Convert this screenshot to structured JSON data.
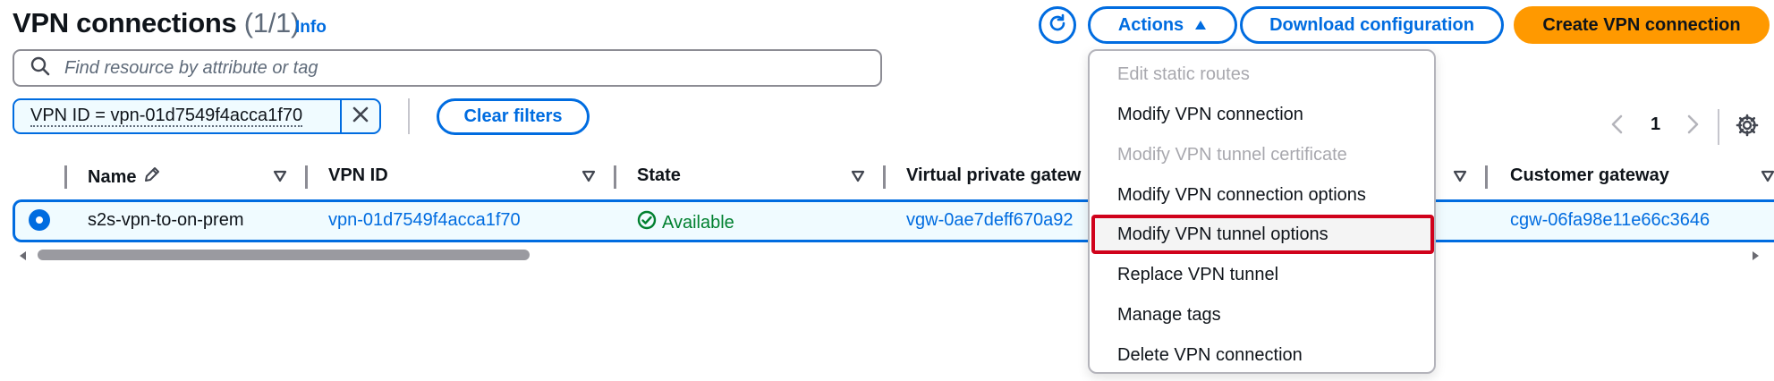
{
  "header": {
    "title": "VPN connections",
    "count": "(1/1)",
    "info": "Info"
  },
  "toolbar": {
    "actions_label": "Actions",
    "download_label": "Download configuration",
    "create_label": "Create VPN connection"
  },
  "search": {
    "placeholder": "Find resource by attribute or tag",
    "value": ""
  },
  "filter": {
    "token": "VPN ID = vpn-01d7549f4acca1f70",
    "clear_label": "Clear filters"
  },
  "pagination": {
    "current_page": "1"
  },
  "table": {
    "columns": [
      "Name",
      "VPN ID",
      "State",
      "Virtual private gatew",
      "",
      "Customer gateway"
    ],
    "rows": [
      {
        "name": "s2s-vpn-to-on-prem",
        "vpn_id": "vpn-01d7549f4acca1f70",
        "state": "Available",
        "vgw": "vgw-0ae7deff670a92",
        "cgw": "cgw-06fa98e11e66c3646",
        "selected": true
      }
    ]
  },
  "actions_menu": {
    "items": [
      {
        "label": "Edit static routes",
        "disabled": true
      },
      {
        "label": "Modify VPN connection",
        "disabled": false
      },
      {
        "label": "Modify VPN tunnel certificate",
        "disabled": true
      },
      {
        "label": "Modify VPN connection options",
        "disabled": false
      },
      {
        "label": "Modify VPN tunnel options",
        "disabled": false,
        "highlighted": true
      },
      {
        "label": "Replace VPN tunnel",
        "disabled": false
      },
      {
        "label": "Manage tags",
        "disabled": false
      },
      {
        "label": "Delete VPN connection",
        "disabled": false
      }
    ]
  },
  "colors": {
    "link": "#006ce0",
    "primary_button": "#ff9900",
    "success": "#00802f",
    "highlight_border": "#d0021b"
  },
  "icons": [
    "refresh-icon",
    "caret-up-icon",
    "search-icon",
    "close-icon",
    "angle-left-icon",
    "angle-right-icon",
    "settings-icon",
    "edit-icon",
    "sort-caret-down-icon",
    "status-positive-icon"
  ]
}
